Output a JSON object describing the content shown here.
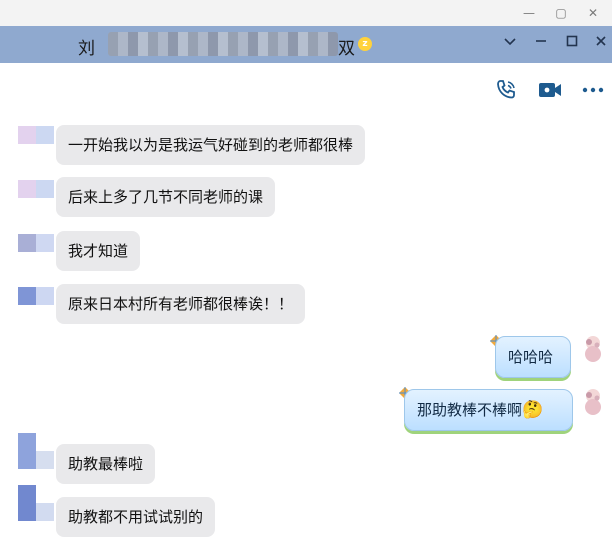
{
  "window": {
    "minimize_icon": "minimize-icon",
    "restore_icon": "restore-icon",
    "close_icon": "close-icon"
  },
  "chat_header": {
    "title_prefix": "刘",
    "title_suffix": "双",
    "badge": "z",
    "controls": [
      "chevron-down-icon",
      "minimize-icon",
      "maximize-icon",
      "close-icon"
    ]
  },
  "toolbar": {
    "icons": [
      "voice-call-icon",
      "video-call-icon",
      "more-icon"
    ]
  },
  "messages": [
    {
      "side": "in",
      "text": "一开始我以为是我运气好碰到的老师都很棒"
    },
    {
      "side": "in",
      "text": "后来上多了几节不同老师的课"
    },
    {
      "side": "in",
      "text": "我才知道"
    },
    {
      "side": "in",
      "text": "原来日本村所有老师都很棒诶！！"
    },
    {
      "side": "out",
      "text": "哈哈哈"
    },
    {
      "side": "out",
      "text": "那助教棒不棒啊"
    },
    {
      "side": "in",
      "text": "助教最棒啦"
    },
    {
      "side": "in",
      "text": "助教都不用试试别的"
    }
  ],
  "emoji": {
    "name": "thinking-face-icon",
    "glyph": "🤔"
  },
  "colors": {
    "title_bar": "#8fa9cf",
    "incoming_bubble": "#e9e9eb",
    "outgoing_bubble": "#cfe8ff",
    "icon_accent": "#1e5b8f"
  }
}
